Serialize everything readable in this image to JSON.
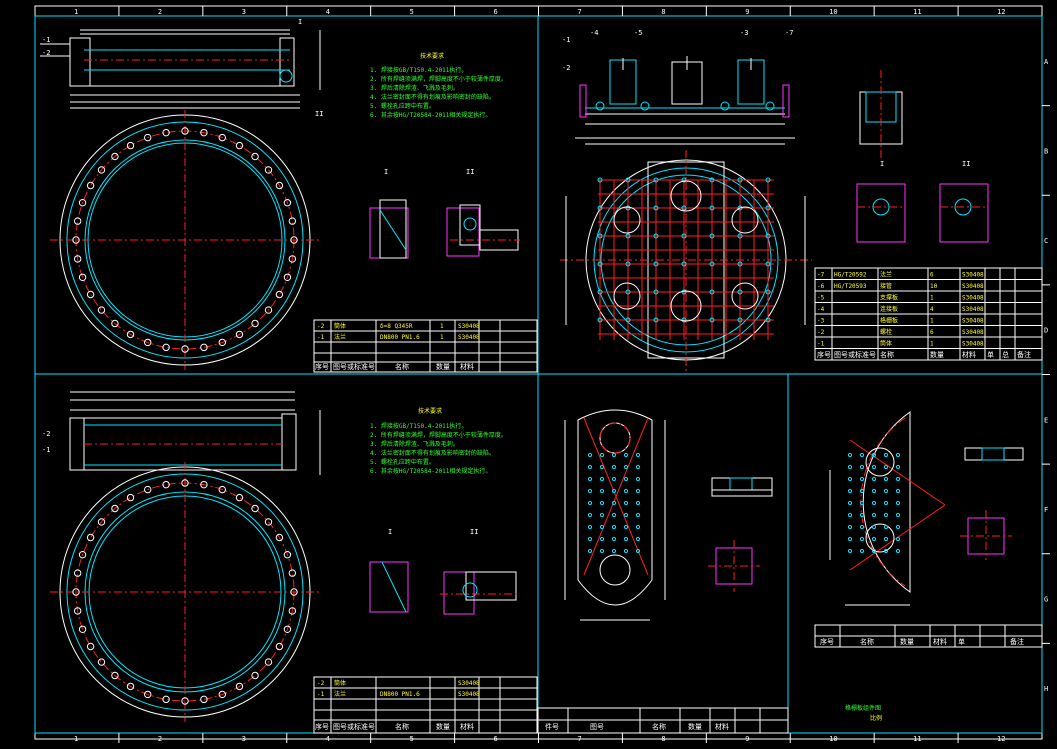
{
  "border": {
    "columns": [
      "1",
      "2",
      "3",
      "4",
      "5",
      "6",
      "7",
      "8",
      "9",
      "10",
      "11",
      "12"
    ],
    "rows": [
      "A",
      "B",
      "C",
      "D",
      "E",
      "F",
      "G",
      "H"
    ]
  },
  "panels": {
    "top_left": {
      "tech_title": "技术要求",
      "tech_notes": [
        "1. 焊接按GB/T150.4-2011执行。",
        "2. 所有焊缝须满焊，焊脚高度不小于较薄件厚度。",
        "3. 焊后清除焊渣、飞溅及毛刺。",
        "4. 法兰密封面不得有划痕及影响密封的缺陷。",
        "5. 螺栓孔应跨中布置。",
        "6. 其余按HG/T20584-2011相关规定执行。"
      ],
      "detail_labels": [
        "I",
        "II"
      ],
      "detail_scale": "放大比例",
      "roughness": "其余",
      "bom_rows": [
        [
          "-2",
          "筒体",
          "δ=8 Q345R",
          "1",
          "S30408",
          "",
          "",
          ""
        ],
        [
          "-1",
          "法兰",
          "DN800 PN1.6",
          "1",
          "S30408",
          "",
          "",
          ""
        ],
        [
          "序号",
          "图号或标准号",
          "名称",
          "数量",
          "材料",
          "单",
          "总",
          "备注"
        ]
      ]
    },
    "top_right": {
      "leaders": [
        "-1",
        "-2",
        "-3",
        "-4",
        "-5",
        "-6",
        "-7"
      ],
      "section_label": "A-A",
      "detail_labels": [
        "I",
        "II"
      ],
      "bom_rows": [
        [
          "-7",
          "HG/T20592",
          "法兰",
          "6",
          "S30408",
          "",
          "",
          ""
        ],
        [
          "-6",
          "HG/T20593",
          "接管",
          "10",
          "S30408",
          "",
          "",
          ""
        ],
        [
          "-5",
          "",
          "支撑板",
          "1",
          "S30408",
          "",
          "",
          ""
        ],
        [
          "-4",
          "",
          "连接板",
          "4",
          "S30408",
          "",
          "",
          ""
        ],
        [
          "-3",
          "",
          "格栅板",
          "1",
          "S30408",
          "",
          "",
          ""
        ],
        [
          "-2",
          "",
          "螺栓",
          "6",
          "S30408",
          "",
          "",
          ""
        ],
        [
          "-1",
          "",
          "筒体",
          "1",
          "S30408",
          "",
          "",
          ""
        ],
        [
          "序号",
          "图号或标准号",
          "名称",
          "数量",
          "材料",
          "单",
          "总",
          "备注"
        ]
      ]
    },
    "bottom_left": {
      "tech_title": "技术要求",
      "detail_labels": [
        "I",
        "II"
      ],
      "bom_rows": [
        [
          "-2",
          "筒体",
          "",
          "1",
          "S30408",
          "",
          "",
          ""
        ],
        [
          "-1",
          "法兰",
          "DN800 PN1.6",
          "1",
          "S30408",
          "",
          "",
          ""
        ],
        [
          "序号",
          "图号或标准号",
          "名称",
          "数量",
          "材料",
          "单",
          "总",
          "备注"
        ]
      ]
    },
    "bottom_middle": {
      "bom_rows": [
        [
          "件号",
          "图号",
          "名称",
          "数量",
          "材料",
          "单",
          "总",
          "备注"
        ]
      ]
    },
    "bottom_right": {
      "bom_rows": [
        [
          "序号",
          "名称",
          "数量",
          "材料",
          "单",
          "总",
          "备注"
        ]
      ],
      "drawing_title": "格栅板组件图",
      "drawing_subtitle": "比例"
    }
  },
  "colors": {
    "background": "#000000",
    "frame": "#00e5ff",
    "outline": "#ffffff",
    "centerline": "#ff2020",
    "detail_box": "#ff33ff",
    "notes": "#33ff33",
    "title_text": "#ffff33"
  }
}
